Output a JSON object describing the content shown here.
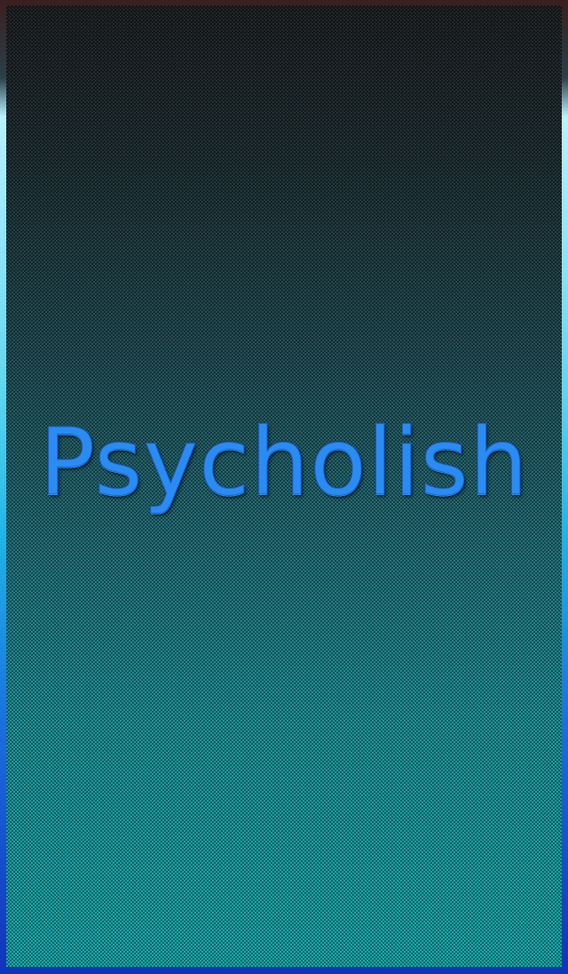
{
  "app": {
    "title": "Psycholish"
  },
  "colors": {
    "title_text": "#2a8cf2",
    "background_top": "#1b1e20",
    "background_bottom": "#13a4a7",
    "frame_border": "#1133bb"
  }
}
